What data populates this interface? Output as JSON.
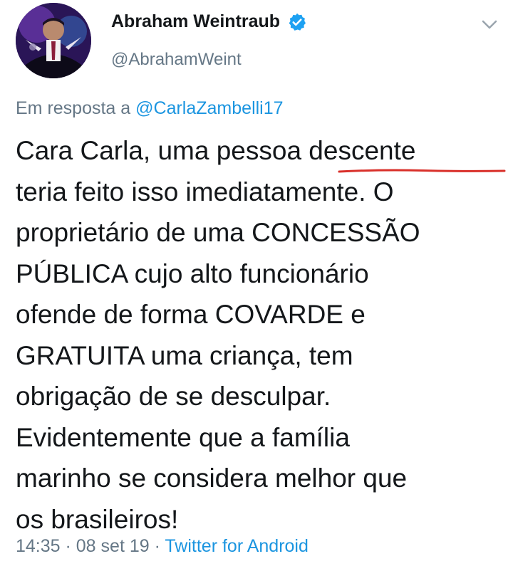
{
  "author": {
    "display_name": "Abraham Weintraub",
    "handle": "@AbrahamWeint",
    "verified": true
  },
  "reply": {
    "prefix": "Em resposta a ",
    "mention": "@CarlaZambelli17"
  },
  "tweet_lines": [
    "Cara Carla, uma pessoa descente",
    "teria feito isso imediatamente. O",
    "proprietário de uma CONCESSÃO",
    "PÚBLICA cujo alto funcionário",
    "ofende de forma COVARDE e",
    "GRATUITA uma criança, tem",
    "obrigação de se desculpar.",
    "Evidentemente que a família",
    "marinho se considera melhor que",
    "os brasileiros!"
  ],
  "meta": {
    "time": "14:35",
    "separator": " · ",
    "date": "08 set 19",
    "source": "Twitter for Android"
  },
  "icons": {
    "verified": "verified-badge-icon",
    "menu": "chevron-down-icon"
  },
  "colors": {
    "link": "#1b95e0",
    "secondary": "#657786",
    "text": "#14171a",
    "annotation": "#d9302a"
  }
}
